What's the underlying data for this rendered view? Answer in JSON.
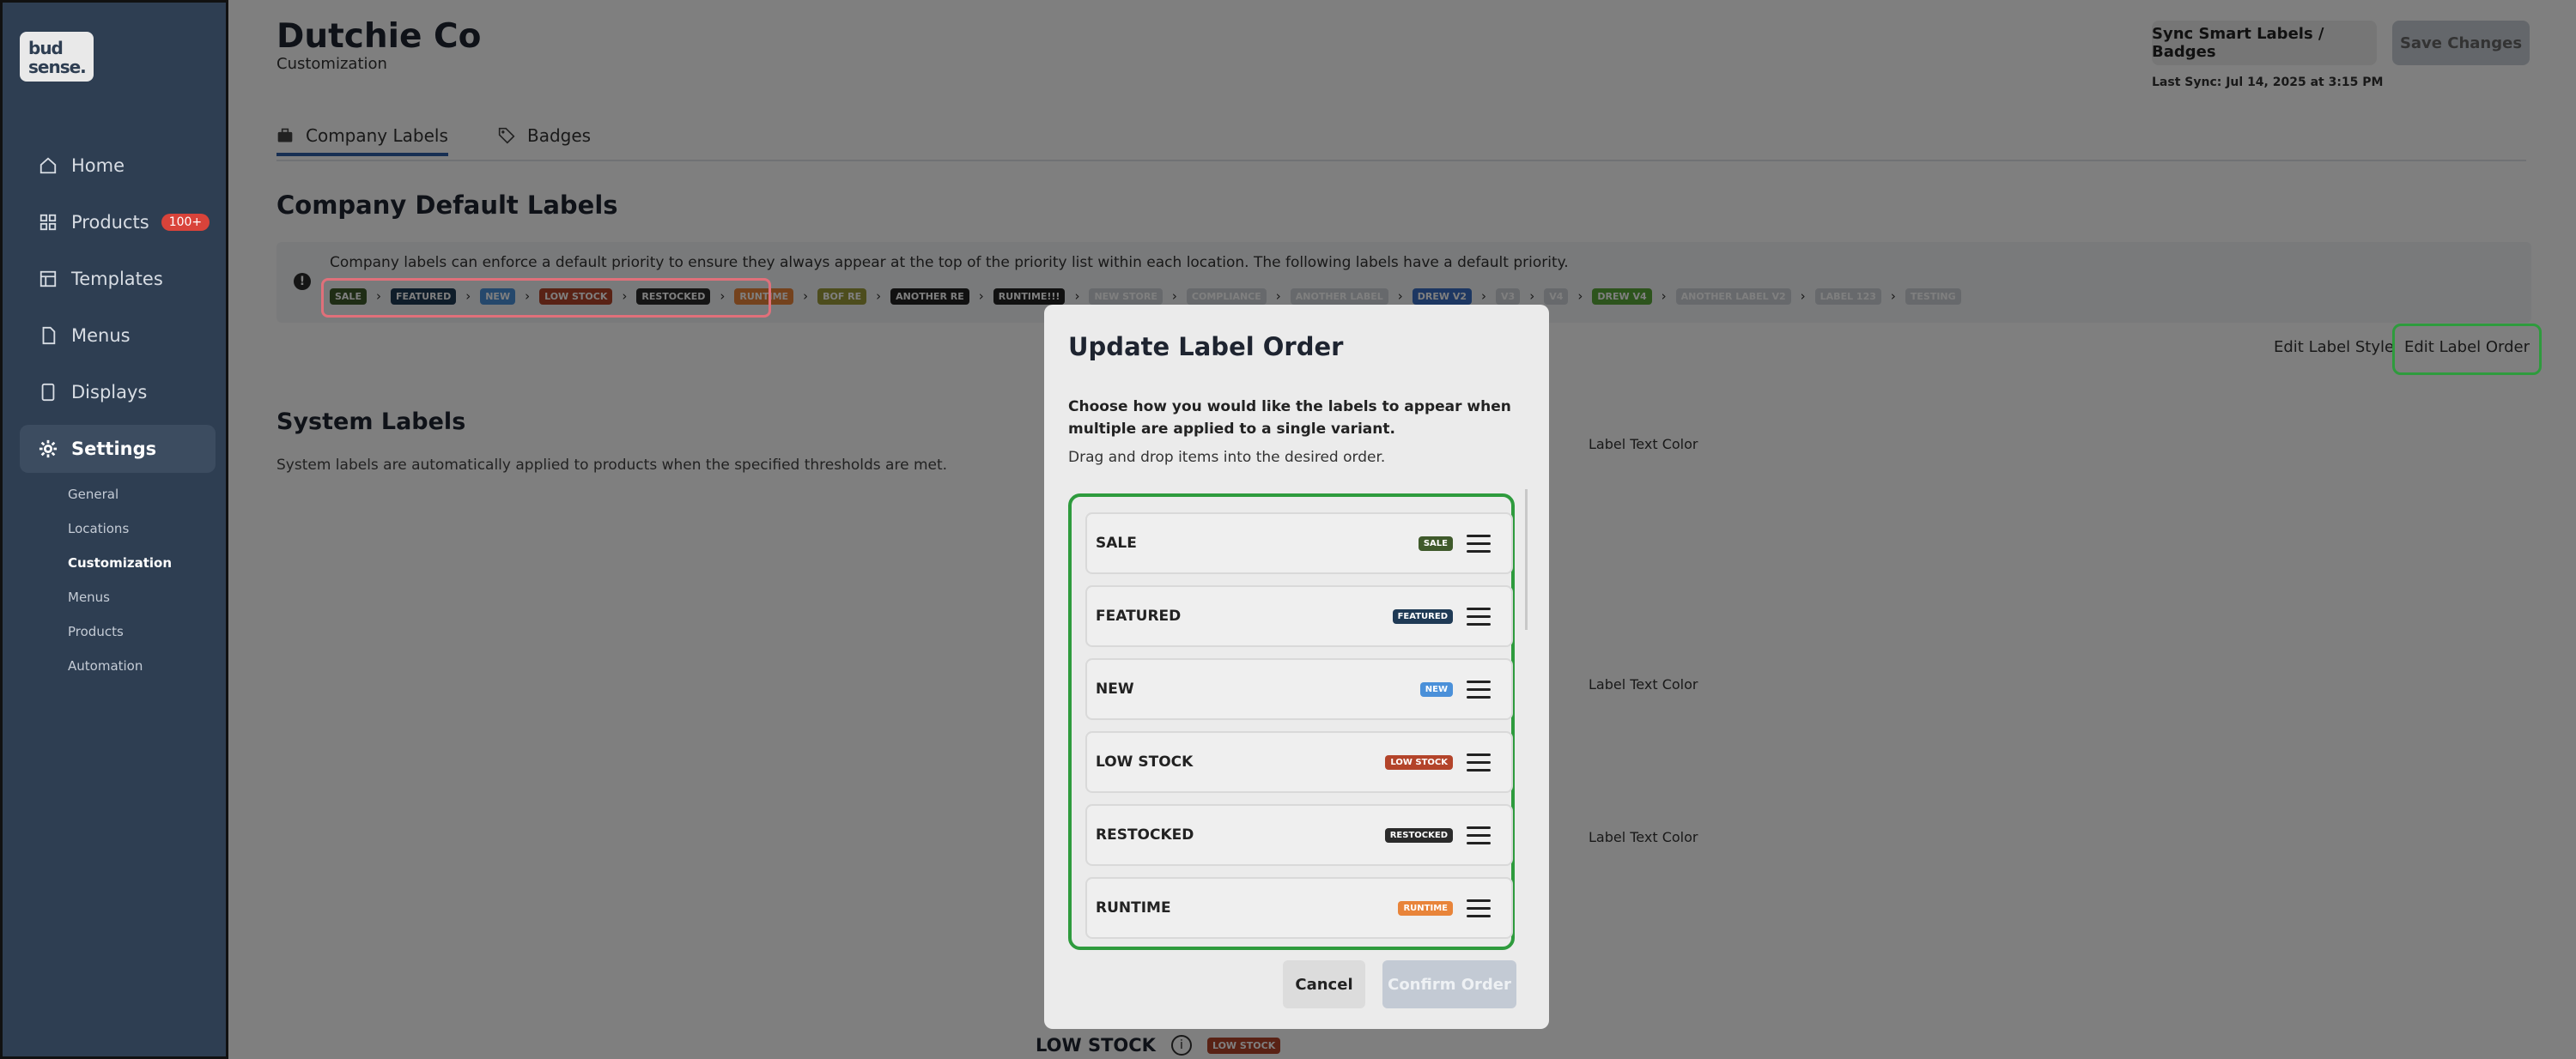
{
  "sidebar": {
    "logo_line1": "bud",
    "logo_line2": "sense.",
    "nav": [
      {
        "label": "Home",
        "icon": "home-icon"
      },
      {
        "label": "Products",
        "icon": "grid-icon",
        "badge": "100+"
      },
      {
        "label": "Templates",
        "icon": "template-icon"
      },
      {
        "label": "Menus",
        "icon": "document-icon"
      },
      {
        "label": "Displays",
        "icon": "display-icon"
      },
      {
        "label": "Settings",
        "icon": "gear-icon"
      }
    ],
    "settings_sub": [
      "General",
      "Locations",
      "Customization",
      "Menus",
      "Products",
      "Automation"
    ],
    "active_sub": "Customization"
  },
  "header": {
    "title": "Dutchie Co",
    "subtitle": "Customization",
    "sync_button": "Sync Smart Labels / Badges",
    "save_button": "Save Changes",
    "last_sync": "Last Sync: Jul 14, 2025 at 3:15 PM"
  },
  "tabs": [
    {
      "label": "Company Labels",
      "icon": "briefcase-icon",
      "active": true
    },
    {
      "label": "Badges",
      "icon": "tag-icon",
      "active": false
    }
  ],
  "company_defaults": {
    "heading": "Company Default Labels",
    "info_text": "Company labels can enforce a default priority to ensure they always appear at the top of the priority list within each location. The following labels have a default priority.",
    "chain": [
      {
        "label": "SALE",
        "color": "#3f5a2b"
      },
      {
        "label": "FEATURED",
        "color": "#1f3a55"
      },
      {
        "label": "NEW",
        "color": "#4a90d9"
      },
      {
        "label": "LOW STOCK",
        "color": "#b3442a"
      },
      {
        "label": "RESTOCKED",
        "color": "#2b2b2b"
      },
      {
        "label": "RUNTIME",
        "color": "#e8843a"
      },
      {
        "label": "BOF RE",
        "color": "#9a9a3a"
      },
      {
        "label": "ANOTHER RE",
        "color": "#222222"
      },
      {
        "label": "RUNTIME!!!",
        "color": "#222222"
      },
      {
        "label": "NEW STORE",
        "color": "#cfd3d8"
      },
      {
        "label": "COMPLIANCE",
        "color": "#cfd3d8"
      },
      {
        "label": "ANOTHER LABEL",
        "color": "#cfd3d8"
      },
      {
        "label": "DREW V2",
        "color": "#3a6fc4"
      },
      {
        "label": "V3",
        "color": "#cfd3d8"
      },
      {
        "label": "V4",
        "color": "#cfd3d8"
      },
      {
        "label": "DREW V4",
        "color": "#5aa83a"
      },
      {
        "label": "ANOTHER LABEL V2",
        "color": "#cfd3d8"
      },
      {
        "label": "LABEL 123",
        "color": "#cfd3d8"
      },
      {
        "label": "TESTING",
        "color": "#cfd3d8"
      }
    ],
    "edit_style_link": "Edit Label Style",
    "edit_order_link": "Edit Label Order"
  },
  "system_labels": {
    "heading": "System Labels",
    "description": "System labels are automatically applied to products when the specified thresholds are met.",
    "label_text_color": "Label Text Color",
    "low_stock_heading": "LOW STOCK",
    "low_stock_chip": "LOW STOCK"
  },
  "modal": {
    "title": "Update Label Order",
    "description": "Choose how you would like the labels to appear when multiple are applied to a single variant.",
    "subtext": "Drag and drop items into the desired order.",
    "items": [
      {
        "name": "SALE",
        "chip": "SALE",
        "color": "#3f5a2b"
      },
      {
        "name": "FEATURED",
        "chip": "FEATURED",
        "color": "#1f3a55"
      },
      {
        "name": "NEW",
        "chip": "NEW",
        "color": "#4a90d9"
      },
      {
        "name": "LOW STOCK",
        "chip": "LOW STOCK",
        "color": "#b3442a"
      },
      {
        "name": "RESTOCKED",
        "chip": "RESTOCKED",
        "color": "#2b2b2b"
      },
      {
        "name": "RUNTIME",
        "chip": "RUNTIME",
        "color": "#e8843a"
      }
    ],
    "cancel": "Cancel",
    "confirm": "Confirm Order"
  }
}
